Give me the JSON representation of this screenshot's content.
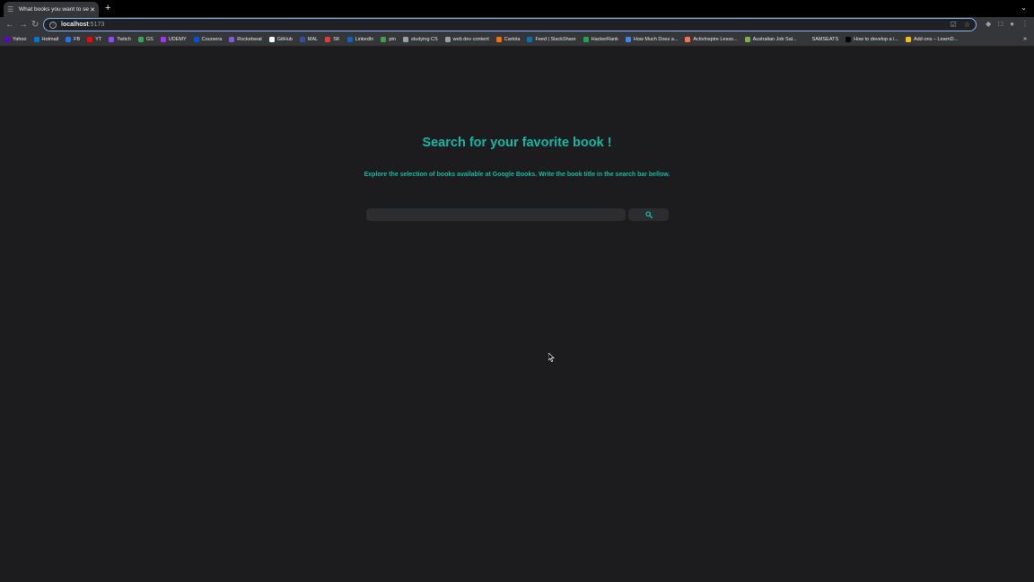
{
  "browser": {
    "tab_title": "What books you want to search",
    "url_host": "localhost",
    "url_port": ":5173"
  },
  "bookmarks": [
    {
      "label": "Yahoo",
      "icon": "yahoo-icon",
      "color": "#6001d2"
    },
    {
      "label": "Hotmail",
      "icon": "hotmail-icon",
      "color": "#0078d4"
    },
    {
      "label": "FB",
      "icon": "facebook-icon",
      "color": "#1877f2"
    },
    {
      "label": "YT",
      "icon": "youtube-icon",
      "color": "#ff0000"
    },
    {
      "label": "Twitch",
      "icon": "twitch-icon",
      "color": "#9146ff"
    },
    {
      "label": "GS",
      "icon": "gs-icon",
      "color": "#34a853"
    },
    {
      "label": "UDEMY",
      "icon": "udemy-icon",
      "color": "#a435f0"
    },
    {
      "label": "Coursera",
      "icon": "coursera-icon",
      "color": "#0056d2"
    },
    {
      "label": "Rocketseat",
      "icon": "rocketseat-icon",
      "color": "#8257e5"
    },
    {
      "label": "GitHub",
      "icon": "github-icon",
      "color": "#ffffff"
    },
    {
      "label": "MAL",
      "icon": "mal-icon",
      "color": "#2e51a2"
    },
    {
      "label": "SK",
      "icon": "sk-icon",
      "color": "#e53935"
    },
    {
      "label": "LinkedIn",
      "icon": "linkedin-icon",
      "color": "#0a66c2"
    },
    {
      "label": "ptn",
      "icon": "ptn-icon",
      "color": "#43a047"
    },
    {
      "label": "studying CS",
      "icon": "folder-icon",
      "color": "#9aa0a6"
    },
    {
      "label": "web dev content",
      "icon": "folder-icon",
      "color": "#9aa0a6"
    },
    {
      "label": "Cartola",
      "icon": "cartola-icon",
      "color": "#ff6d00"
    },
    {
      "label": "Feed | SlackShare",
      "icon": "slideshare-icon",
      "color": "#0077b5"
    },
    {
      "label": "HackerRank",
      "icon": "hackerrank-icon",
      "color": "#1ba94c"
    },
    {
      "label": "How Much Does a...",
      "icon": "page-icon",
      "color": "#4285f4"
    },
    {
      "label": "ActivInspire Lesso...",
      "icon": "activinspire-icon",
      "color": "#ff7043"
    },
    {
      "label": "Australian Job Sal...",
      "icon": "jobs-icon",
      "color": "#7cb342"
    },
    {
      "label": "SAMSEATS",
      "icon": "samseats-icon",
      "color": "#35363a"
    },
    {
      "label": "How to develop a l...",
      "icon": "develop-icon",
      "color": "#000000"
    },
    {
      "label": "Add-ons – LearnD...",
      "icon": "chart-icon",
      "color": "#fbbc04"
    }
  ],
  "main": {
    "title": "Search for your favorite book !",
    "subtitle": "Explore the selection of books available at Google Books. Write the book title in the search bar bellow.",
    "search_placeholder": "",
    "search_value": ""
  },
  "colors": {
    "accent": "#14b8a6",
    "background": "#1c1c1e",
    "input_bg": "#2b2d31"
  }
}
